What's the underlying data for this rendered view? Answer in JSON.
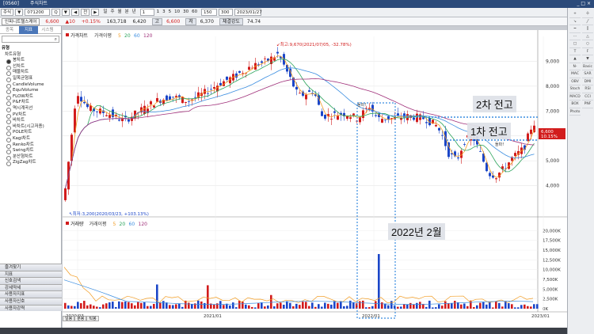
{
  "window": {
    "code": "[0560]",
    "title": "주식차트",
    "buttons": [
      "_",
      "□",
      "×"
    ]
  },
  "toolbar": {
    "market": "주식",
    "code": "071200",
    "buttons": [
      "▼",
      "Q",
      "▼",
      "◀",
      "전",
      "▶"
    ],
    "periods": [
      "일",
      "주",
      "월",
      "분",
      "년"
    ],
    "interval": "1",
    "interval_options": [
      "1",
      "3",
      "5",
      "10",
      "30",
      "60"
    ],
    "count": "150",
    "total": "300",
    "date": "2023/01/27"
  },
  "info": {
    "name": "인피니트헬스케어",
    "price": "6,600",
    "change": "▲10",
    "change_pct": "+0.15%",
    "volume": "163,718",
    "open": "6,420",
    "high_label": "고",
    "high": "6,600",
    "low_label": "저",
    "low": "6,370",
    "strength_label": "체결강도",
    "strength": "74.74"
  },
  "left_panel": {
    "tabs": [
      "종목",
      "지표",
      "시스템"
    ],
    "active_tab": 1,
    "tree_title": "유형",
    "tree_group": "차트유형",
    "items": [
      "봉차트",
      "선차트",
      "매물차트",
      "일목균형표",
      "CandleVolume",
      "EquiVolume",
      "FLOW차트",
      "P&F차트",
      "역시계곡선",
      "PV차트",
      "바차트",
      "바차트(시고저종)",
      "POLE차트",
      "Kagi차트",
      "Renko차트",
      "Swing차트",
      "분산형차트",
      "ZigZag차트"
    ],
    "selected_index": 0,
    "bottom": [
      "즐겨찾기",
      "지표",
      "신호검색",
      "강세약세",
      "사용자지표",
      "사용자신호",
      "사용자강력"
    ]
  },
  "chart": {
    "price_legend": [
      "가격차트",
      "가격이평",
      "5",
      "20",
      "60",
      "120"
    ],
    "volume_legend": [
      "거래량",
      "거래이평",
      "5",
      "20",
      "60",
      "120"
    ],
    "high_note": "최고:9,670(2021/07/05, -32.78%)",
    "low_note": "최저:3,200(2020/03/23, +103.13%)",
    "break_label": "돌파!",
    "break_label2": "돌파!",
    "current_price": "6,600",
    "current_pct": "10.15%",
    "price_ticks": [
      "9,000",
      "8,000",
      "7,000",
      "6,000",
      "5,000",
      "4,000"
    ],
    "volume_ticks": [
      "20,000K",
      "17,500K",
      "15,000K",
      "12,500K",
      "10,000K",
      "7,500K",
      "5,000K",
      "2,500K",
      "0K"
    ],
    "dates": [
      "2020/03",
      "2021/01",
      "2022/01",
      "2023/01"
    ]
  },
  "annotations": {
    "resistance2": "2차 전고",
    "resistance1": "1차 전고",
    "month_box": "2022년 2월"
  },
  "bottom_tabs": [
    "일봉",
    "분봉",
    "틱봉"
  ],
  "right_tools": [
    "+",
    "十",
    "↘",
    "╱",
    "━",
    "┃",
    "⋯",
    "△",
    "□",
    "○",
    "T",
    "F",
    "▲",
    "▼",
    "N-Basic",
    "Basic",
    "MAC",
    "SAR",
    "OBV",
    "DMI",
    "Stoch",
    "RSI",
    "MACD",
    "CCI",
    "BOX",
    "PNF",
    "Photo"
  ],
  "colors": {
    "up": "#d21c1c",
    "down": "#1b46c8",
    "ma5": "#f29c22",
    "ma20": "#2aa35a",
    "ma60": "#3a8de0",
    "ma120": "#a0307a"
  }
}
